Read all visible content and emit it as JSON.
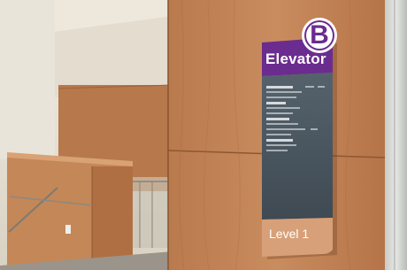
{
  "sign": {
    "header_text": "Elevator",
    "badge_letter": "B",
    "footer_text": "Level 1",
    "colors": {
      "header": "#6b2c8f",
      "panel": "#4a5660",
      "footer": "#d8a078",
      "badge_fill": "#ffffff"
    }
  },
  "directory": {
    "legible": false,
    "row_count": 20
  },
  "colors": {
    "wall": "#e8e2d4",
    "wood": "#c8895a",
    "floor": "#9a948a"
  }
}
